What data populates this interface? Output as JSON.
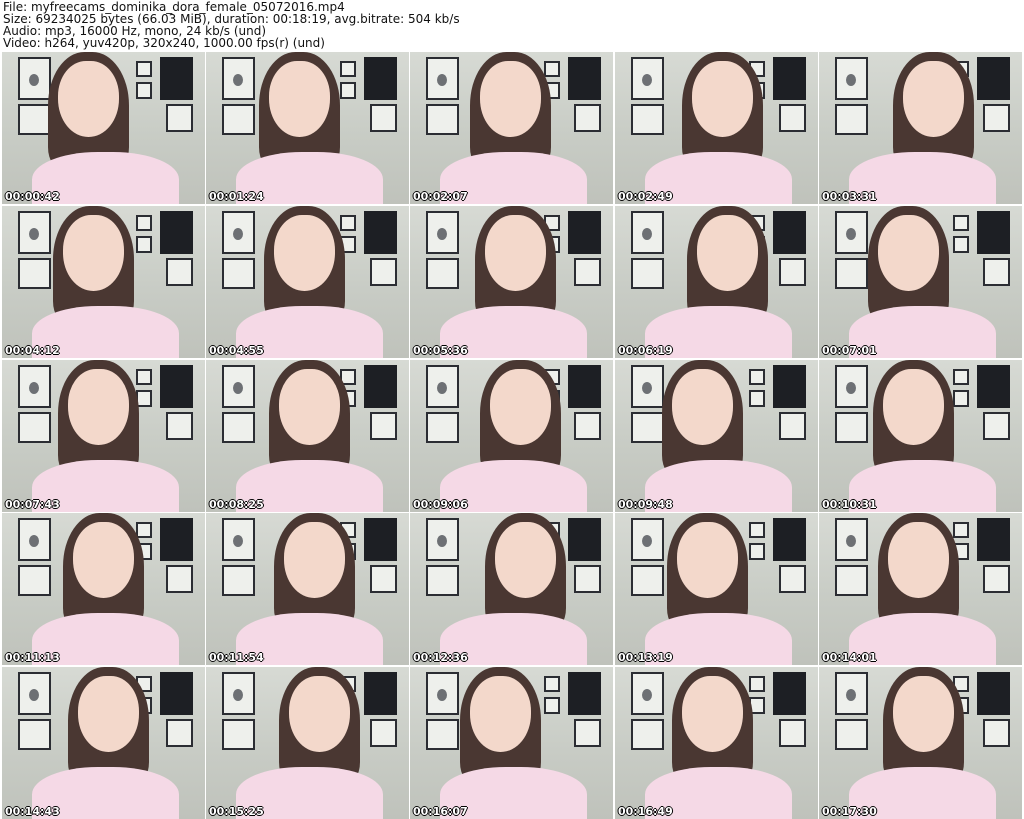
{
  "header": {
    "file": "File: myfreecams_dominika_dora_female_05072016.mp4",
    "size": "Size: 69234025 bytes (66.03 MiB), duration: 00:18:19, avg.bitrate: 504 kb/s",
    "audio": "Audio: mp3, 16000 Hz, mono, 24 kb/s (und)",
    "video": "Video: h264, yuv420p, 320x240, 1000.00 fps(r) (und)"
  },
  "thumbnails": [
    {
      "time": "00:00:42"
    },
    {
      "time": "00:01:24"
    },
    {
      "time": "00:02:07"
    },
    {
      "time": "00:02:49"
    },
    {
      "time": "00:03:31"
    },
    {
      "time": "00:04:12"
    },
    {
      "time": "00:04:55"
    },
    {
      "time": "00:05:36"
    },
    {
      "time": "00:06:19"
    },
    {
      "time": "00:07:01"
    },
    {
      "time": "00:07:43"
    },
    {
      "time": "00:08:25"
    },
    {
      "time": "00:09:06"
    },
    {
      "time": "00:09:48"
    },
    {
      "time": "00:10:31"
    },
    {
      "time": "00:11:13"
    },
    {
      "time": "00:11:54"
    },
    {
      "time": "00:12:36"
    },
    {
      "time": "00:13:19"
    },
    {
      "time": "00:14:01"
    },
    {
      "time": "00:14:43"
    },
    {
      "time": "00:15:25"
    },
    {
      "time": "00:16:07"
    },
    {
      "time": "00:16:49"
    },
    {
      "time": "00:17:30"
    }
  ]
}
